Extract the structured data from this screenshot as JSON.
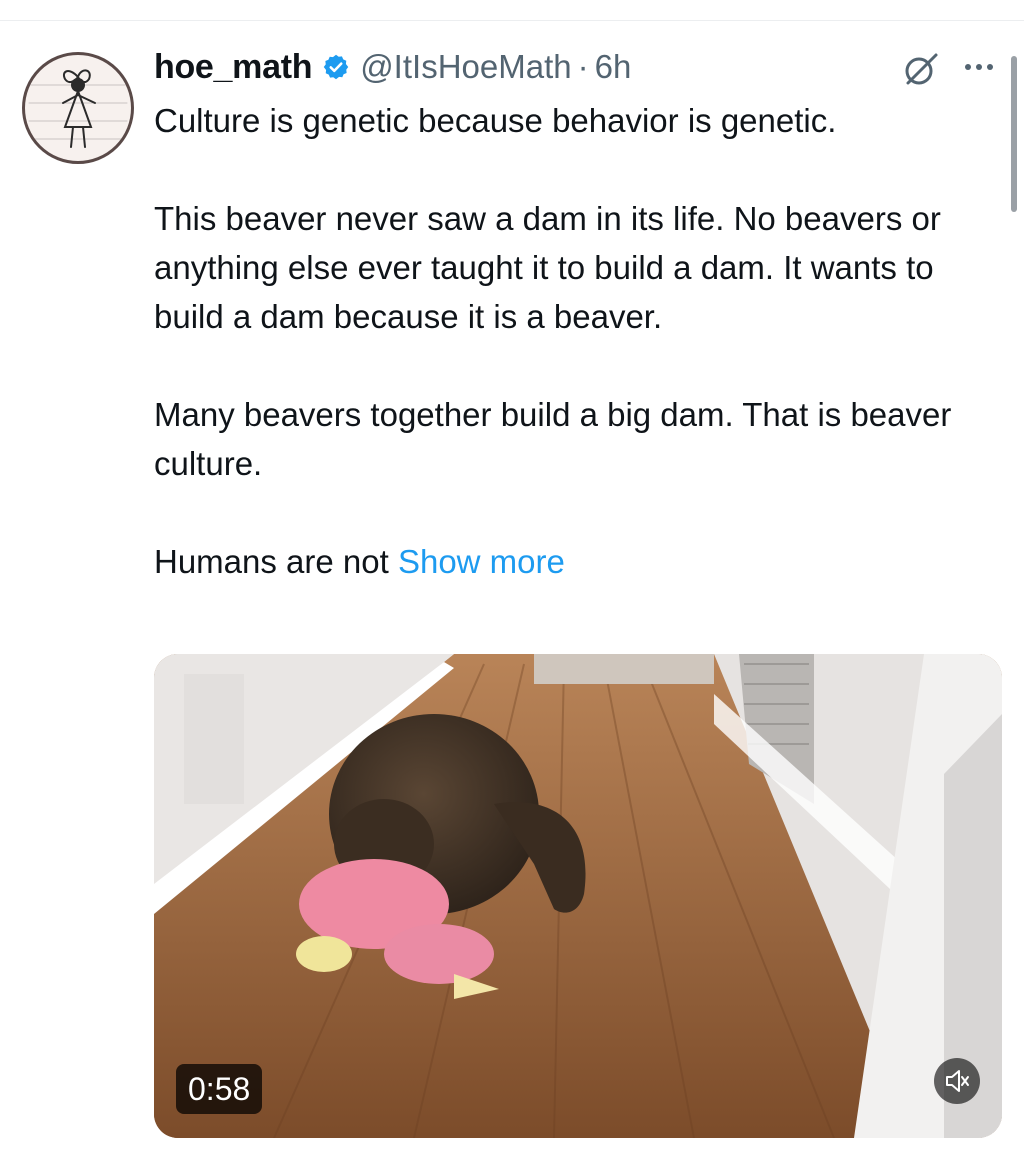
{
  "tweet": {
    "author_name": "hoe_math",
    "handle": "@ItIsHoeMath",
    "separator": "·",
    "time": "6h",
    "paragraphs": [
      "Culture is genetic because behavior is genetic.",
      "This beaver never saw a dam in its life. No beavers or anything else ever taught it to build a dam. It wants to build a dam because it is a beaver.",
      "Many beavers together build a big dam. That is beaver culture."
    ],
    "truncated_text": "Humans are not ",
    "show_more_label": "Show more",
    "verified_badge_color": "#1d9bf0",
    "link_color": "#1d9bf0"
  },
  "media": {
    "duration": "0:58",
    "muted": true
  },
  "icons": {
    "avatar": "stick-figure-drawing",
    "verified": "verified-badge-icon",
    "grok": "grok-icon",
    "more": "more-options-icon",
    "mute": "speaker-muted-icon"
  }
}
